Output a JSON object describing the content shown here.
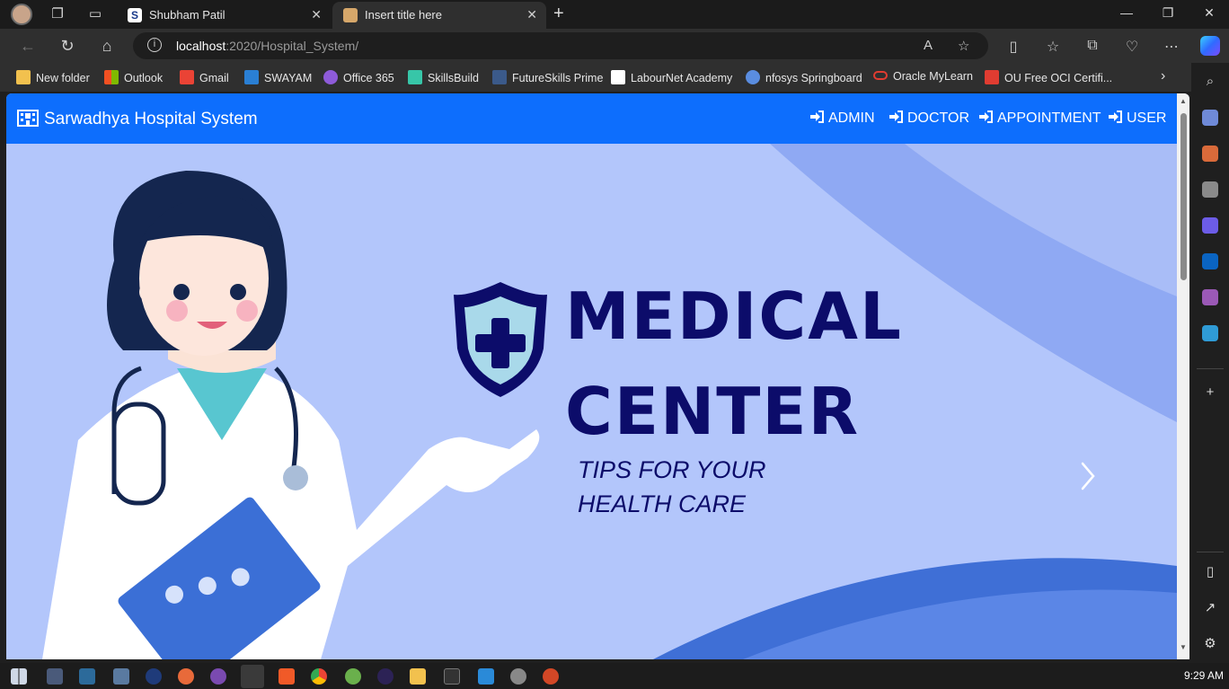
{
  "browser": {
    "tabs": [
      {
        "label": "Shubham Patil",
        "favicon": "S"
      },
      {
        "label": "Insert title here"
      }
    ],
    "url_host": "localhost",
    "url_path": ":2020/Hospital_System/",
    "bookmarks": [
      {
        "label": "New folder",
        "color": "#f2c14e"
      },
      {
        "label": "Outlook",
        "color": "#e74c3c"
      },
      {
        "label": "Gmail",
        "color": "#ea4335"
      },
      {
        "label": "SWAYAM",
        "color": "#2a7fd4"
      },
      {
        "label": "Office 365",
        "color": "#8e5bd9"
      },
      {
        "label": "SkillsBuild",
        "color": "#37c6a8"
      },
      {
        "label": "FutureSkills Prime",
        "color": "#3b5a8a"
      },
      {
        "label": "LabourNet Academy",
        "color": "#ffffff"
      },
      {
        "label": "nfosys Springboard",
        "color": "#5a8de0"
      },
      {
        "label": "Oracle MyLearn",
        "color": "#e03c31"
      },
      {
        "label": "OU Free OCI Certifi...",
        "color": "#e03c31"
      }
    ]
  },
  "page": {
    "brand": "Sarwadhya Hospital System",
    "nav": [
      "ADMIN",
      "DOCTOR",
      "APPOINTMENT",
      "USER"
    ],
    "hero": {
      "line1": "MEDICAL",
      "line2": "CENTER",
      "tips1": "TIPS FOR YOUR",
      "tips2": "HEALTH CARE"
    },
    "colors": {
      "navbar": "#0d6efd",
      "hero_bg": "#b3c6fb",
      "hero_text": "#0c0c6a"
    }
  },
  "taskbar": {
    "clock": "9:29 AM"
  }
}
